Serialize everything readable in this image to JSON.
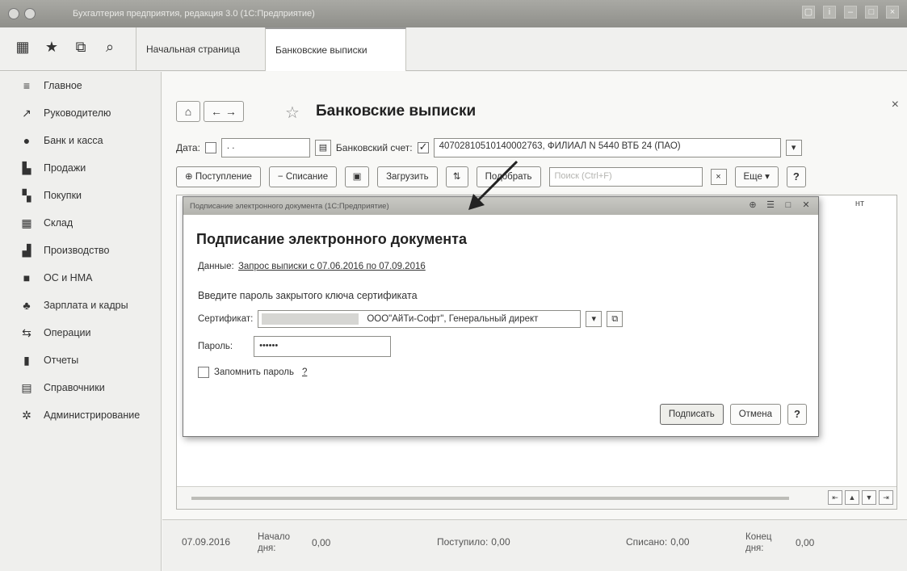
{
  "window": {
    "title": "Бухгалтерия предприятия, редакция 3.0 (1С:Предприятие)",
    "controls": [
      "▢",
      "i",
      "–",
      "□",
      "×"
    ]
  },
  "tabs": {
    "home": "Начальная страница",
    "active": "Банковские выписки"
  },
  "sidebar": {
    "items": [
      {
        "label": "Главное",
        "icon": "menu-icon",
        "glyph": "≡"
      },
      {
        "label": "Руководителю",
        "icon": "trend-icon",
        "glyph": "↗"
      },
      {
        "label": "Банк и касса",
        "icon": "coin-icon",
        "glyph": "●"
      },
      {
        "label": "Продажи",
        "icon": "bag-icon",
        "glyph": "▙"
      },
      {
        "label": "Покупки",
        "icon": "cart-icon",
        "glyph": "▚"
      },
      {
        "label": "Склад",
        "icon": "warehouse-icon",
        "glyph": "▦"
      },
      {
        "label": "Производство",
        "icon": "factory-icon",
        "glyph": "▟"
      },
      {
        "label": "ОС и НМА",
        "icon": "truck-icon",
        "glyph": "■"
      },
      {
        "label": "Зарплата и кадры",
        "icon": "people-icon",
        "glyph": "♣"
      },
      {
        "label": "Операции",
        "icon": "operations-icon",
        "glyph": "⇆"
      },
      {
        "label": "Отчеты",
        "icon": "chart-icon",
        "glyph": "▮"
      },
      {
        "label": "Справочники",
        "icon": "book-icon",
        "glyph": "▤"
      },
      {
        "label": "Администрирование",
        "icon": "gear-icon",
        "glyph": "✲"
      }
    ]
  },
  "form": {
    "title": "Банковские выписки",
    "date_label": "Дата:",
    "date_value": " . .",
    "account_label": "Банковский счет:",
    "account_value": "40702810510140002763, ФИЛИАЛ N 5440 ВТБ 24 (ПАО)",
    "toolbar": {
      "receipt": "⊕ Поступление",
      "writeoff": "− Списание",
      "load": "Загрузить",
      "select": "Подобрать",
      "search_placeholder": "Поиск (Ctrl+F)",
      "more": "Еще",
      "help": "?"
    },
    "grid_column": "нт"
  },
  "footer": {
    "date": "07.09.2016",
    "start_label": "Начало дня:",
    "start_value": "0,00",
    "income_label": "Поступило:",
    "income_value": "0,00",
    "outcome_label": "Списано:",
    "outcome_value": "0,00",
    "end_label": "Конец дня:",
    "end_value": "0,00"
  },
  "dialog": {
    "window_title": "Подписание электронного документа (1С:Предприятие)",
    "heading": "Подписание электронного документа",
    "data_label": "Данные:",
    "data_link": "Запрос выписки с 07.06.2016 по 07.09.2016",
    "prompt": "Введите пароль закрытого ключа сертификата",
    "cert_label": "Сертификат:",
    "cert_value": "ООО\"АйТи-Софт\", Генеральный директ",
    "password_label": "Пароль:",
    "password_value": "••••••",
    "remember_label": "Запомнить пароль",
    "remember_help": "?",
    "sign_button": "Подписать",
    "cancel_button": "Отмена",
    "help_button": "?"
  }
}
